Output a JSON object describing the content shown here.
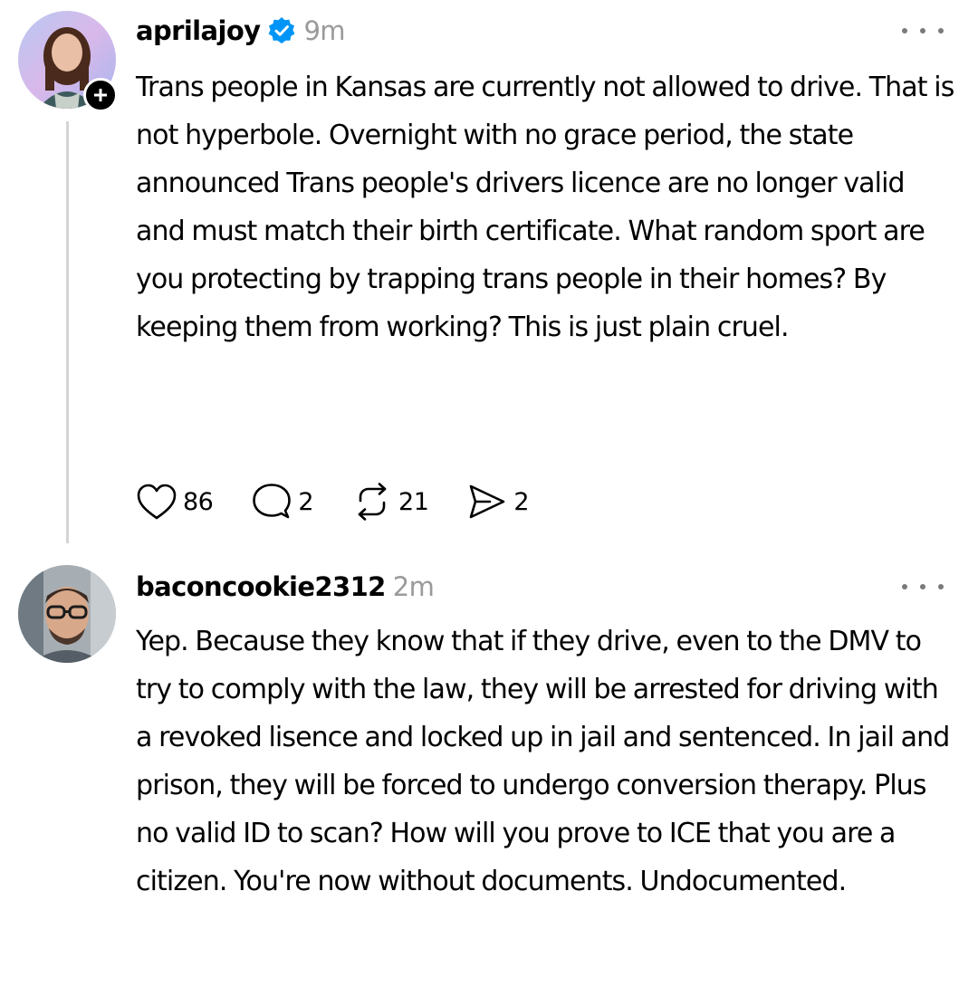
{
  "posts": [
    {
      "username": "aprilajoy",
      "verified": true,
      "time": "9m",
      "text": "Trans people in Kansas are currently not allowed to drive. That is not hyperbole. Overnight with no grace period, the state announced Trans people's drivers licence are no longer valid and must match their birth certificate. What random sport are you protecting by trapping trans people in their homes? By keeping them from working? This is just plain cruel.",
      "likes": "86",
      "replies": "2",
      "reposts": "21",
      "shares": "2",
      "icons": {
        "like": "heart-icon",
        "reply": "comment-bubble-icon",
        "repost": "repost-arrows-icon",
        "share": "send-icon",
        "more": "ellipsis-icon",
        "follow": "plus-icon",
        "verified": "verified-check-icon"
      }
    },
    {
      "username": "baconcookie2312",
      "time": "2m",
      "text": "Yep. Because they know that if they drive, even to the DMV to try to comply with the law, they will be arrested for driving with a revoked  lisence and locked up in jail and sentenced. In jail and prison, they will be forced to undergo conversion therapy. Plus no valid ID to scan? How will you prove to ICE that you are a citizen. You're now without documents. Undocumented.",
      "icons": {
        "more": "ellipsis-icon"
      }
    }
  ],
  "colors": {
    "verified_blue": "#0095f6",
    "timestamp_gray": "#9a9a9a",
    "thread_line": "#d4d4d4"
  }
}
